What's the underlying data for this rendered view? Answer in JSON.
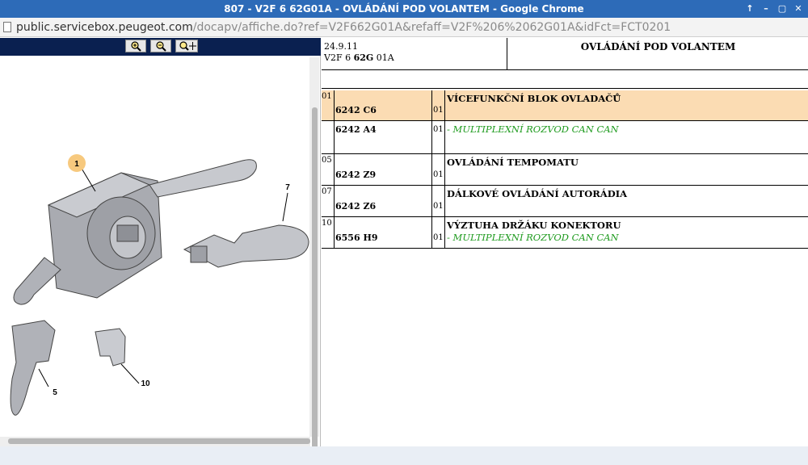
{
  "window": {
    "title": "807 - V2F 6 62G01A - OVLÁDÁNÍ POD VOLANTEM - Google Chrome",
    "controls": [
      "↑",
      "–",
      "▢",
      "✕"
    ]
  },
  "address": {
    "host": "public.servicebox.peugeot.com",
    "path": "/docapv/affiche.do?ref=V2F662G01A&refaff=V2F%206%2062G01A&idFct=FCT0201"
  },
  "toolbar": {
    "zoom_in": "zoom-in-icon",
    "zoom_out": "zoom-out-icon",
    "pan": "pan-zoom-icon"
  },
  "drawing": {
    "callouts": [
      "1",
      "7",
      "5",
      "10"
    ]
  },
  "doc": {
    "date": "24.9.11",
    "code_prefix": "V2F 6 ",
    "code_bold": "62G",
    "code_suffix": " 01A",
    "title": "OVLÁDÁNÍ POD VOLANTEM"
  },
  "rows": [
    {
      "num": "01",
      "label": "VÍCEFUNKČNÍ BLOK OVLADAČŮ",
      "ref": "6242 C6",
      "qty": "01",
      "highlight": true
    },
    {
      "num": "",
      "ref": "6242 A4",
      "qty": "01",
      "sub": "- MULTIPLEXNÍ ROZVOD CAN CAN"
    },
    {
      "num": "05",
      "label": "OVLÁDÁNÍ TEMPOMATU",
      "ref": "6242 Z9",
      "qty": "01"
    },
    {
      "num": "07",
      "label": "DÁLKOVÉ OVLÁDÁNÍ AUTORÁDIA",
      "ref": "6242 Z6",
      "qty": "01"
    },
    {
      "num": "10",
      "label": "VÝZTUHA DRŽÁKU KONEKTORU",
      "ref": "6556 H9",
      "qty": "01",
      "sub": "- MULTIPLEXNÍ ROZVOD CAN CAN"
    }
  ],
  "colors": {
    "highlight": "#fbdcb3",
    "green_text": "#1f9b1f",
    "titlebar": "#2d6bb8",
    "toolbar": "#0a2050"
  }
}
